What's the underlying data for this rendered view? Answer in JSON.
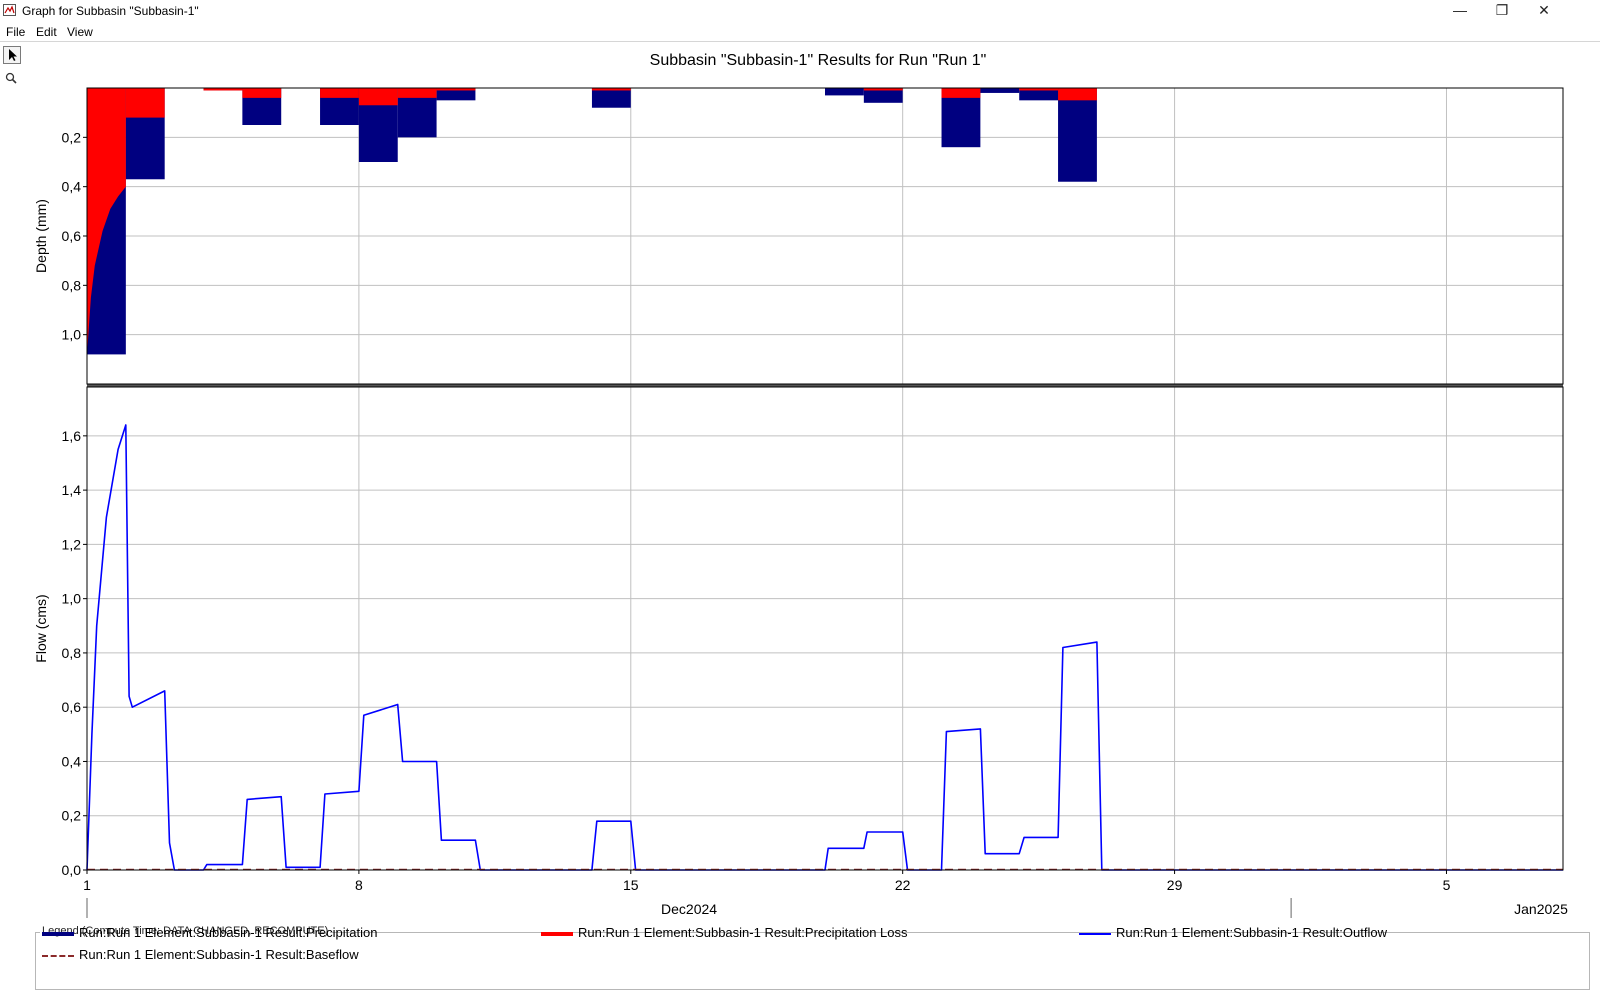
{
  "window": {
    "title": "Graph for Subbasin \"Subbasin-1\"",
    "controls": {
      "minimize": "—",
      "restore": "❐",
      "close": "✕"
    }
  },
  "menu": [
    "File",
    "Edit",
    "View"
  ],
  "toolbar": {
    "tools": [
      "arrow-pointer-icon",
      "zoom-magnifier-icon"
    ]
  },
  "colors": {
    "precipitation": "#000080",
    "precipitation_loss": "#ff0000",
    "outflow": "#0000ff",
    "baseflow": "#8b2a2a",
    "grid": "#c0c0c0"
  },
  "chart_data": {
    "title": "Subbasin \"Subbasin-1\" Results for Run \"Run 1\"",
    "type": "bar",
    "x_axis": {
      "start": "2024-12-01",
      "end": "2025-01-08",
      "tick_dates": [
        "2024-12-01",
        "2024-12-08",
        "2024-12-15",
        "2024-12-22",
        "2024-12-29",
        "2025-01-05"
      ],
      "tick_labels": [
        "1",
        "8",
        "15",
        "22",
        "29",
        "5"
      ],
      "month_labels": [
        {
          "label": "Dec2024",
          "start": "2024-12-01",
          "end": "2025-01-01"
        },
        {
          "label": "Jan2025",
          "start": "2025-01-01",
          "end": "2025-01-08"
        }
      ],
      "grid": true
    },
    "depth_panel": {
      "ylabel": "Depth (mm)",
      "ylim": [
        0,
        1.2
      ],
      "inverted": true,
      "yticks": [
        0.2,
        0.4,
        0.6,
        0.8,
        1.0
      ],
      "ytick_labels": [
        "0,2",
        "0,4",
        "0,6",
        "0,8",
        "1,0"
      ],
      "series": [
        {
          "name": "Run:Run 1 Element:Subbasin-1 Result:Precipitation",
          "bars": [
            {
              "start": "2024-12-01",
              "end": "2024-12-02",
              "value": 1.08
            },
            {
              "start": "2024-12-02",
              "end": "2024-12-03",
              "value": 0.37
            },
            {
              "start": "2024-12-04",
              "end": "2024-12-05",
              "value": 0.01
            },
            {
              "start": "2024-12-05",
              "end": "2024-12-06",
              "value": 0.15
            },
            {
              "start": "2024-12-06",
              "end": "2024-12-07",
              "value": 0.0
            },
            {
              "start": "2024-12-07",
              "end": "2024-12-08",
              "value": 0.15
            },
            {
              "start": "2024-12-08",
              "end": "2024-12-09",
              "value": 0.3
            },
            {
              "start": "2024-12-09",
              "end": "2024-12-10",
              "value": 0.2
            },
            {
              "start": "2024-12-10",
              "end": "2024-12-11",
              "value": 0.05
            },
            {
              "start": "2024-12-14",
              "end": "2024-12-15",
              "value": 0.08
            },
            {
              "start": "2024-12-20",
              "end": "2024-12-21",
              "value": 0.03
            },
            {
              "start": "2024-12-21",
              "end": "2024-12-22",
              "value": 0.06
            },
            {
              "start": "2024-12-23",
              "end": "2024-12-24",
              "value": 0.24
            },
            {
              "start": "2024-12-24",
              "end": "2024-12-25",
              "value": 0.02
            },
            {
              "start": "2024-12-25",
              "end": "2024-12-26",
              "value": 0.05
            },
            {
              "start": "2024-12-26",
              "end": "2024-12-27",
              "value": 0.38
            }
          ]
        },
        {
          "name": "Run:Run 1 Element:Subbasin-1 Result:Precipitation Loss",
          "bars": [
            {
              "start": "2024-12-02",
              "end": "2024-12-03",
              "value": 0.12
            },
            {
              "start": "2024-12-04",
              "end": "2024-12-05",
              "value": 0.01
            },
            {
              "start": "2024-12-05",
              "end": "2024-12-06",
              "value": 0.04
            },
            {
              "start": "2024-12-06",
              "end": "2024-12-07",
              "value": 0.0
            },
            {
              "start": "2024-12-07",
              "end": "2024-12-08",
              "value": 0.04
            },
            {
              "start": "2024-12-08",
              "end": "2024-12-09",
              "value": 0.07
            },
            {
              "start": "2024-12-09",
              "end": "2024-12-10",
              "value": 0.04
            },
            {
              "start": "2024-12-10",
              "end": "2024-12-11",
              "value": 0.01
            },
            {
              "start": "2024-12-14",
              "end": "2024-12-15",
              "value": 0.01
            },
            {
              "start": "2024-12-20",
              "end": "2024-12-21",
              "value": 0.0
            },
            {
              "start": "2024-12-21",
              "end": "2024-12-22",
              "value": 0.01
            },
            {
              "start": "2024-12-23",
              "end": "2024-12-24",
              "value": 0.04
            },
            {
              "start": "2024-12-24",
              "end": "2024-12-25",
              "value": 0.0
            },
            {
              "start": "2024-12-25",
              "end": "2024-12-26",
              "value": 0.01
            },
            {
              "start": "2024-12-26",
              "end": "2024-12-27",
              "value": 0.05
            }
          ],
          "first_day_curve": {
            "start": "2024-12-01",
            "end": "2024-12-02",
            "points": [
              {
                "t": "2024-12-01T00:00",
                "value": 1.08
              },
              {
                "t": "2024-12-01T02:24",
                "value": 0.85
              },
              {
                "t": "2024-12-01T04:48",
                "value": 0.72
              },
              {
                "t": "2024-12-01T09:36",
                "value": 0.58
              },
              {
                "t": "2024-12-01T14:24",
                "value": 0.49
              },
              {
                "t": "2024-12-01T19:12",
                "value": 0.44
              },
              {
                "t": "2024-12-02T00:00",
                "value": 0.4
              }
            ]
          }
        }
      ]
    },
    "flow_panel": {
      "ylabel": "Flow (cms)",
      "ylim": [
        0,
        1.78
      ],
      "yticks": [
        0.0,
        0.2,
        0.4,
        0.6,
        0.8,
        1.0,
        1.2,
        1.4,
        1.6
      ],
      "ytick_labels": [
        "0,0",
        "0,2",
        "0,4",
        "0,6",
        "0,8",
        "1,0",
        "1,2",
        "1,4",
        "1,6"
      ],
      "series": [
        {
          "name": "Run:Run 1 Element:Subbasin-1 Result:Outflow",
          "points": [
            {
              "t": "2024-12-01T00:00",
              "value": 0.0
            },
            {
              "t": "2024-12-01T03:00",
              "value": 0.5
            },
            {
              "t": "2024-12-01T06:00",
              "value": 0.9
            },
            {
              "t": "2024-12-01T12:00",
              "value": 1.3
            },
            {
              "t": "2024-12-01T19:12",
              "value": 1.55
            },
            {
              "t": "2024-12-02T00:00",
              "value": 1.64
            },
            {
              "t": "2024-12-02T02:00",
              "value": 0.64
            },
            {
              "t": "2024-12-02T04:00",
              "value": 0.6
            },
            {
              "t": "2024-12-03T00:00",
              "value": 0.66
            },
            {
              "t": "2024-12-03T03:00",
              "value": 0.1
            },
            {
              "t": "2024-12-03T06:00",
              "value": 0.0
            },
            {
              "t": "2024-12-04T00:00",
              "value": 0.0
            },
            {
              "t": "2024-12-04T02:00",
              "value": 0.02
            },
            {
              "t": "2024-12-05T00:00",
              "value": 0.02
            },
            {
              "t": "2024-12-05T03:00",
              "value": 0.26
            },
            {
              "t": "2024-12-06T00:00",
              "value": 0.27
            },
            {
              "t": "2024-12-06T03:00",
              "value": 0.01
            },
            {
              "t": "2024-12-07T00:00",
              "value": 0.01
            },
            {
              "t": "2024-12-07T03:00",
              "value": 0.28
            },
            {
              "t": "2024-12-08T00:00",
              "value": 0.29
            },
            {
              "t": "2024-12-08T03:00",
              "value": 0.57
            },
            {
              "t": "2024-12-09T00:00",
              "value": 0.61
            },
            {
              "t": "2024-12-09T03:00",
              "value": 0.4
            },
            {
              "t": "2024-12-10T00:00",
              "value": 0.4
            },
            {
              "t": "2024-12-10T03:00",
              "value": 0.11
            },
            {
              "t": "2024-12-11T00:00",
              "value": 0.11
            },
            {
              "t": "2024-12-11T03:00",
              "value": 0.0
            },
            {
              "t": "2024-12-14T00:00",
              "value": 0.0
            },
            {
              "t": "2024-12-14T03:00",
              "value": 0.18
            },
            {
              "t": "2024-12-15T00:00",
              "value": 0.18
            },
            {
              "t": "2024-12-15T03:00",
              "value": 0.0
            },
            {
              "t": "2024-12-20T00:00",
              "value": 0.0
            },
            {
              "t": "2024-12-20T02:00",
              "value": 0.08
            },
            {
              "t": "2024-12-21T00:00",
              "value": 0.08
            },
            {
              "t": "2024-12-21T02:00",
              "value": 0.14
            },
            {
              "t": "2024-12-22T00:00",
              "value": 0.14
            },
            {
              "t": "2024-12-22T03:00",
              "value": 0.0
            },
            {
              "t": "2024-12-23T00:00",
              "value": 0.0
            },
            {
              "t": "2024-12-23T03:00",
              "value": 0.51
            },
            {
              "t": "2024-12-24T00:00",
              "value": 0.52
            },
            {
              "t": "2024-12-24T03:00",
              "value": 0.06
            },
            {
              "t": "2024-12-25T00:00",
              "value": 0.06
            },
            {
              "t": "2024-12-25T03:00",
              "value": 0.12
            },
            {
              "t": "2024-12-26T00:00",
              "value": 0.12
            },
            {
              "t": "2024-12-26T03:00",
              "value": 0.82
            },
            {
              "t": "2024-12-27T00:00",
              "value": 0.84
            },
            {
              "t": "2024-12-27T03:00",
              "value": 0.0
            },
            {
              "t": "2025-01-08T00:00",
              "value": 0.0
            }
          ]
        },
        {
          "name": "Run:Run 1 Element:Subbasin-1 Result:Baseflow",
          "points": [
            {
              "t": "2024-12-01T00:00",
              "value": 0.0
            },
            {
              "t": "2025-01-08T00:00",
              "value": 0.0
            }
          ]
        }
      ]
    }
  },
  "legend": {
    "title": "Legend (Compute Time: DATA CHANGED, RECOMPUTE)",
    "entries": [
      {
        "label": "Run:Run 1 Element:Subbasin-1 Result:Precipitation",
        "style": "thick-solid",
        "color": "#000080"
      },
      {
        "label": "Run:Run 1 Element:Subbasin-1 Result:Precipitation Loss",
        "style": "thick-solid",
        "color": "#ff0000"
      },
      {
        "label": "Run:Run 1 Element:Subbasin-1 Result:Outflow",
        "style": "thin-solid",
        "color": "#0000ff"
      },
      {
        "label": "Run:Run 1 Element:Subbasin-1 Result:Baseflow",
        "style": "dashed",
        "color": "#8b2a2a"
      }
    ]
  }
}
